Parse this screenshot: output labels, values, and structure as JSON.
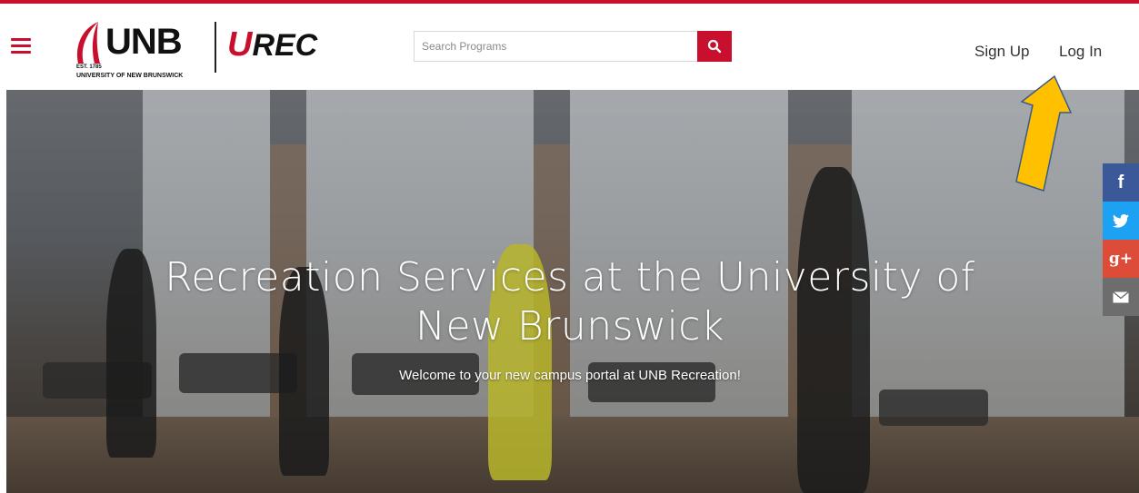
{
  "header": {
    "logo": {
      "unb": "UNB",
      "est": "EST. 1785",
      "university": "UNIVERSITY OF NEW BRUNSWICK",
      "urec_u": "U",
      "urec_rest": "REC"
    },
    "search": {
      "placeholder": "Search Programs"
    },
    "nav": {
      "sign_up": "Sign Up",
      "log_in": "Log In"
    }
  },
  "hero": {
    "title": "Recreation Services at the University of New Brunswick",
    "subtitle": "Welcome to your new campus portal at UNB Recreation!"
  },
  "share": {
    "facebook": "f",
    "twitter": "twitter-bird-icon",
    "googleplus": "g+",
    "email": "envelope-icon"
  },
  "colors": {
    "brand_red": "#c8102e",
    "facebook": "#3b5998",
    "twitter": "#1da1f2",
    "googleplus": "#dd4b39",
    "email": "#6d6d6d",
    "arrow": "#ffc000"
  }
}
